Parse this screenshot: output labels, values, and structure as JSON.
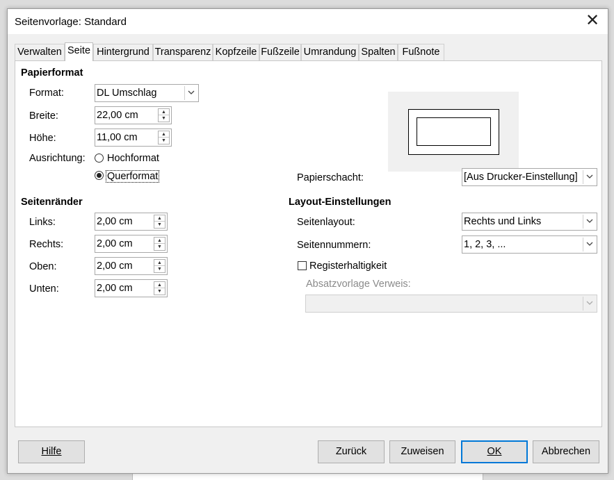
{
  "window": {
    "title": "Seitenvorlage: Standard"
  },
  "tabs": [
    {
      "label": "Verwalten"
    },
    {
      "label": "Seite"
    },
    {
      "label": "Hintergrund"
    },
    {
      "label": "Transparenz"
    },
    {
      "label": "Kopfzeile"
    },
    {
      "label": "Fußzeile"
    },
    {
      "label": "Umrandung"
    },
    {
      "label": "Spalten"
    },
    {
      "label": "Fußnote"
    }
  ],
  "paper": {
    "heading": "Papierformat",
    "format_label": "Format:",
    "format_value": "DL Umschlag",
    "width_label": "Breite:",
    "width_value": "22,00 cm",
    "height_label": "Höhe:",
    "height_value": "11,00 cm",
    "orientation_label": "Ausrichtung:",
    "portrait_label": "Hochformat",
    "landscape_label": "Querformat",
    "selected_orientation": "Querformat",
    "tray_label": "Papierschacht:",
    "tray_value": "[Aus Drucker-Einstellung]"
  },
  "margins": {
    "heading": "Seitenränder",
    "left_label": "Links:",
    "left_value": "2,00 cm",
    "right_label": "Rechts:",
    "right_value": "2,00 cm",
    "top_label": "Oben:",
    "top_value": "2,00 cm",
    "bottom_label": "Unten:",
    "bottom_value": "2,00 cm"
  },
  "layout": {
    "heading": "Layout-Einstellungen",
    "page_layout_label": "Seitenlayout:",
    "page_layout_value": "Rechts und Links",
    "page_numbers_label": "Seitennummern:",
    "page_numbers_value": "1, 2, 3, ...",
    "register_label": "Registerhaltigkeit",
    "register_checked": false,
    "reference_style_label": "Absatzvorlage Verweis:",
    "reference_style_value": ""
  },
  "buttons": {
    "help": "Hilfe",
    "back": "Zurück",
    "apply": "Zuweisen",
    "ok": "OK",
    "cancel": "Abbrechen"
  }
}
